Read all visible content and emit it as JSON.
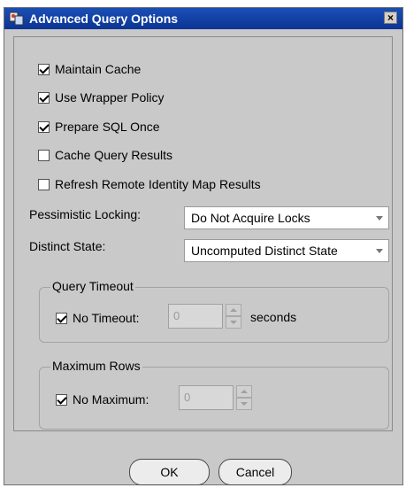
{
  "window": {
    "title": "Advanced Query Options",
    "close_glyph": "×"
  },
  "options": [
    {
      "label": "Maintain Cache",
      "checked": true
    },
    {
      "label": "Use Wrapper Policy",
      "checked": true
    },
    {
      "label": "Prepare SQL Once",
      "checked": true
    },
    {
      "label": "Cache Query Results",
      "checked": false
    },
    {
      "label": "Refresh Remote Identity Map Results",
      "checked": false
    }
  ],
  "pessimistic_locking": {
    "label": "Pessimistic Locking:",
    "value": "Do Not Acquire Locks"
  },
  "distinct_state": {
    "label": "Distinct State:",
    "value": "Uncomputed Distinct State"
  },
  "query_timeout": {
    "title": "Query Timeout",
    "checkbox_label": "No Timeout:",
    "checked": true,
    "value": "0",
    "unit": "seconds"
  },
  "maximum_rows": {
    "title": "Maximum Rows",
    "checkbox_label": "No Maximum:",
    "checked": true,
    "value": "0"
  },
  "buttons": {
    "ok": "OK",
    "cancel": "Cancel"
  }
}
